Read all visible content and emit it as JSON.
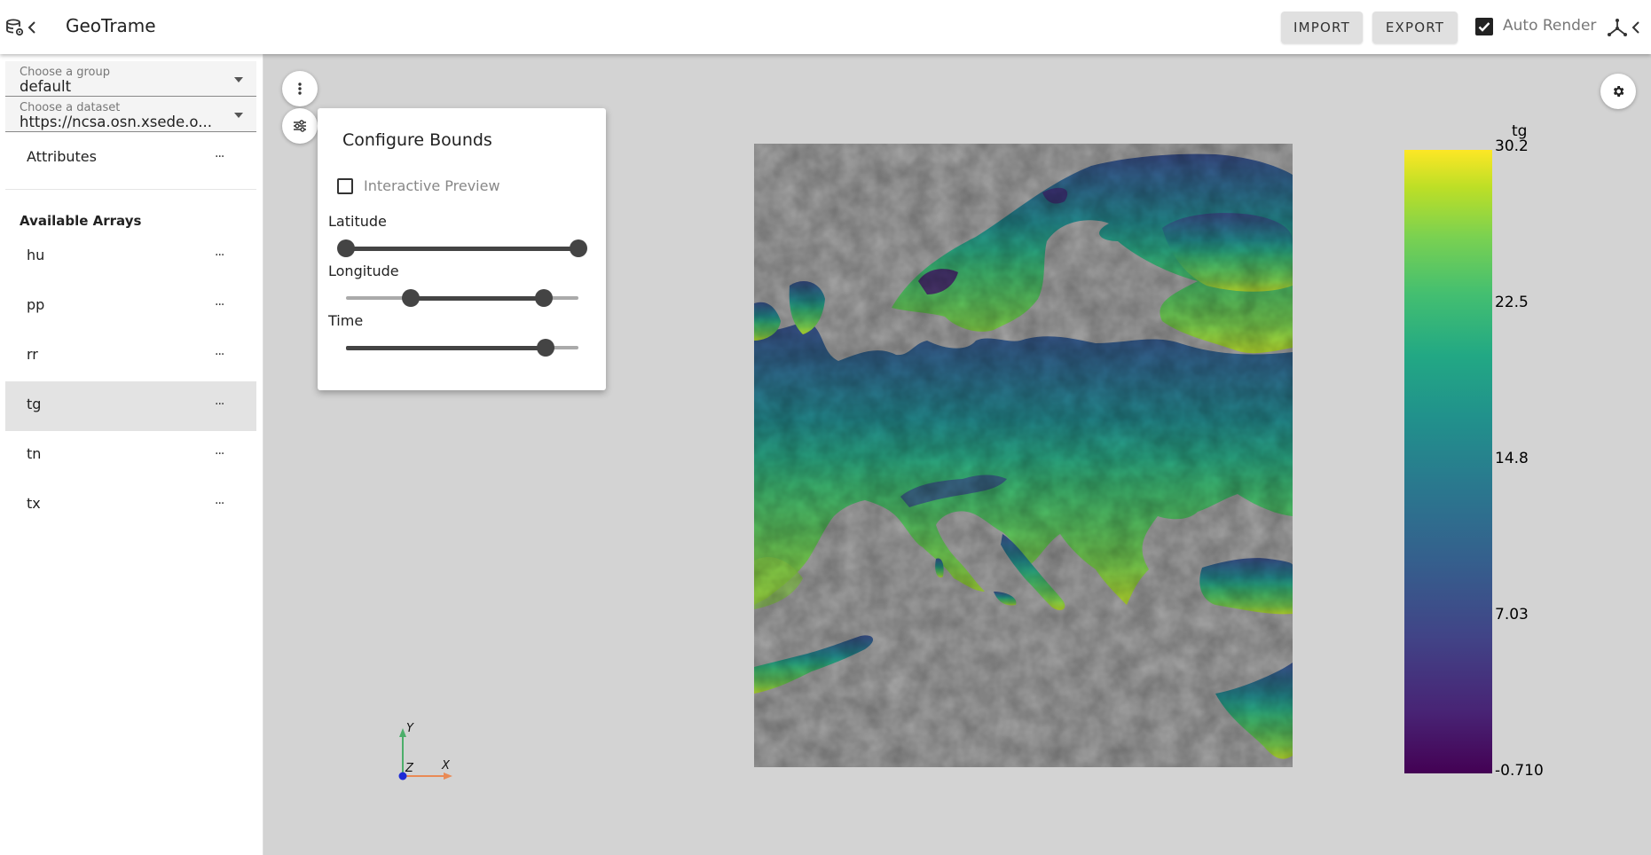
{
  "app": {
    "title": "GeoTrame",
    "import_label": "IMPORT",
    "export_label": "EXPORT",
    "auto_render_label": "Auto Render",
    "auto_render_checked": true
  },
  "sidebar": {
    "group_select": {
      "label": "Choose a group",
      "value": "default"
    },
    "dataset_select": {
      "label": "Choose a dataset",
      "value": "https://ncsa.osn.xsede.o..."
    },
    "attributes_label": "Attributes",
    "more_label": "...",
    "section_title": "Available Arrays",
    "arrays": [
      {
        "name": "hu",
        "active": false
      },
      {
        "name": "pp",
        "active": false
      },
      {
        "name": "rr",
        "active": false
      },
      {
        "name": "tg",
        "active": true
      },
      {
        "name": "tn",
        "active": false
      },
      {
        "name": "tx",
        "active": false
      }
    ]
  },
  "bounds_panel": {
    "title": "Configure Bounds",
    "interactive_preview_label": "Interactive Preview",
    "interactive_preview_checked": false,
    "latitude_label": "Latitude",
    "latitude_range": [
      0,
      1
    ],
    "longitude_label": "Longitude",
    "longitude_range": [
      0.28,
      0.85
    ],
    "time_label": "Time",
    "time_value": 0.86
  },
  "colorbar": {
    "title": "tg",
    "ticks": [
      "30.2",
      "22.5",
      "14.8",
      "7.03",
      "-0.710"
    ],
    "colormap": "viridis",
    "colors": [
      "#440154",
      "#414487",
      "#2a788e",
      "#22a884",
      "#7ad151",
      "#fde725"
    ]
  },
  "axes": {
    "x": "X",
    "y": "Y",
    "z": "Z"
  },
  "colors": {
    "sidebar_active": "#e3e3e3",
    "no_data": "#a6a6a6",
    "viewport_bg": "#d3d3d3"
  }
}
